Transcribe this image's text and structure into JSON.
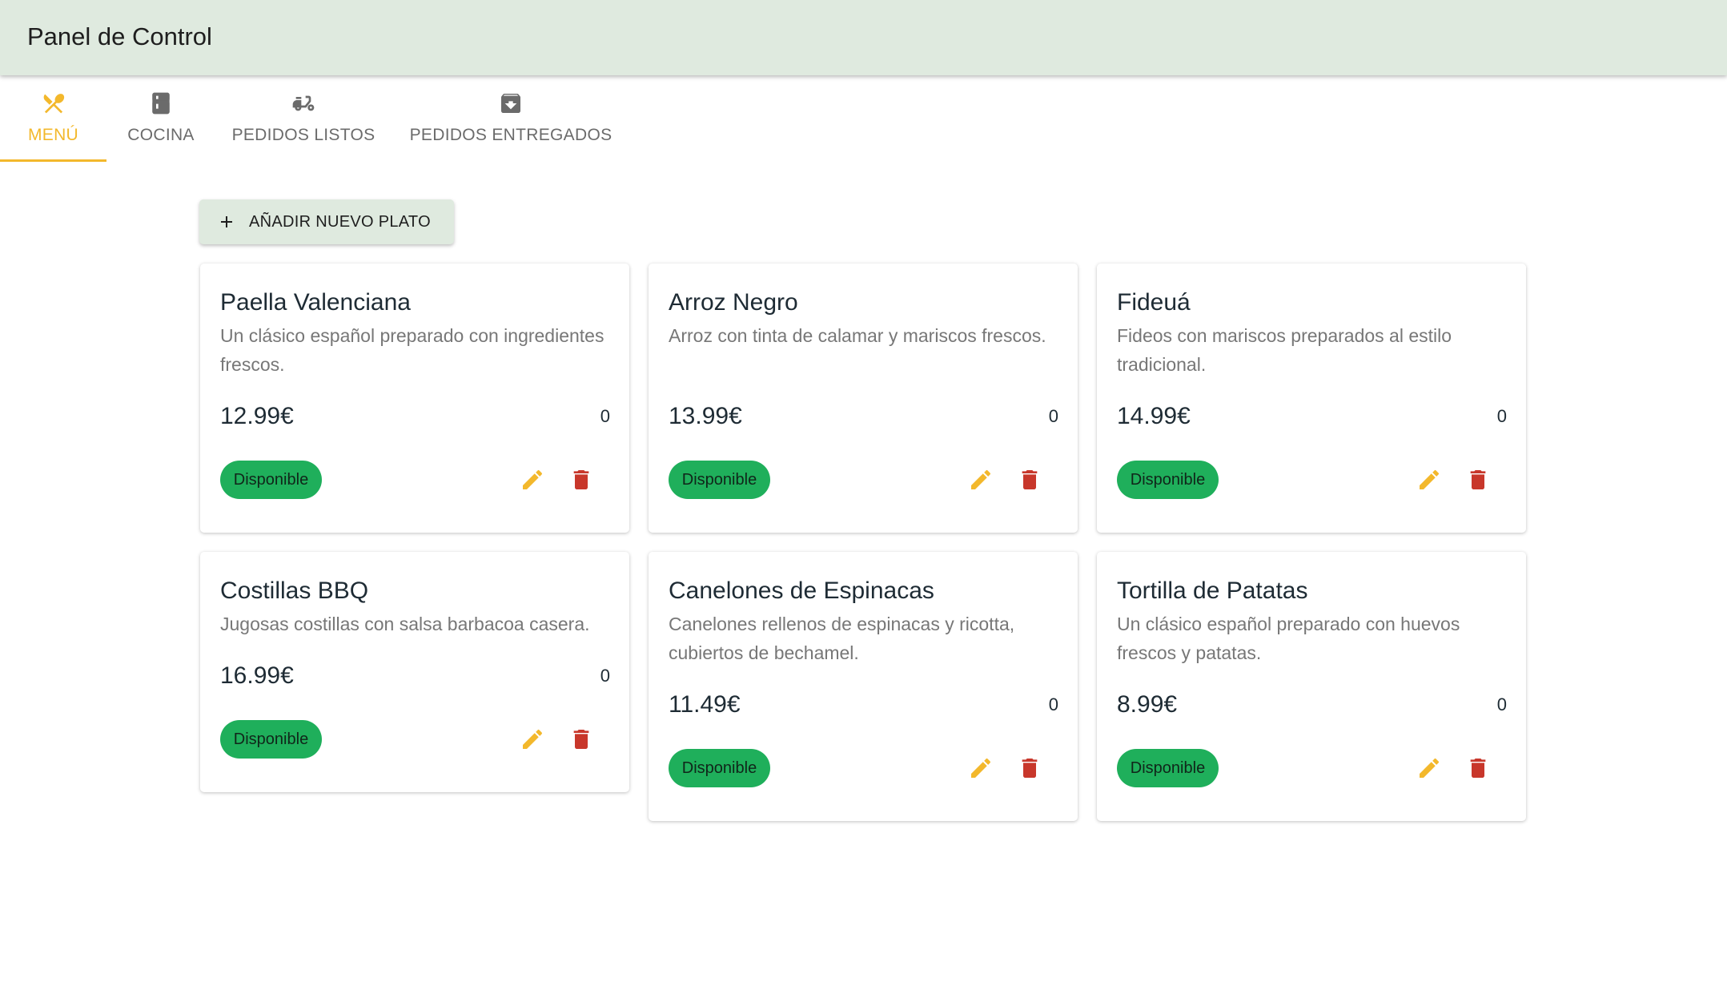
{
  "app": {
    "title": "Panel de Control"
  },
  "tabs": [
    {
      "label": "MENÚ",
      "icon": "utensils-icon",
      "active": true
    },
    {
      "label": "COCINA",
      "icon": "kitchen-icon",
      "active": false
    },
    {
      "label": "PEDIDOS LISTOS",
      "icon": "delivery-scooter-icon",
      "active": false
    },
    {
      "label": "PEDIDOS ENTREGADOS",
      "icon": "archive-box-icon",
      "active": false
    }
  ],
  "toolbar": {
    "add_label": "AÑADIR NUEVO PLATO"
  },
  "dishes": [
    {
      "name": "Paella Valenciana",
      "description": "Un clásico español preparado con ingredientes frescos.",
      "price": "12.99€",
      "count": "0",
      "status": "Disponible"
    },
    {
      "name": "Arroz Negro",
      "description": "Arroz con tinta de calamar y mariscos frescos.",
      "price": "13.99€",
      "count": "0",
      "status": "Disponible"
    },
    {
      "name": "Fideuá",
      "description": "Fideos con mariscos preparados al estilo tradicional.",
      "price": "14.99€",
      "count": "0",
      "status": "Disponible"
    },
    {
      "name": "Costillas BBQ",
      "description": "Jugosas costillas con salsa barbacoa casera.",
      "price": "16.99€",
      "count": "0",
      "status": "Disponible"
    },
    {
      "name": "Canelones de Espinacas",
      "description": "Canelones rellenos de espinacas y ricotta, cubiertos de bechamel.",
      "price": "11.49€",
      "count": "0",
      "status": "Disponible"
    },
    {
      "name": "Tortilla de Patatas",
      "description": "Un clásico español preparado con huevos frescos y patatas.",
      "price": "8.99€",
      "count": "0",
      "status": "Disponible"
    }
  ],
  "colors": {
    "accent": "#f3b82c",
    "appbar": "#dfeadf",
    "available": "#1faf5b",
    "delete": "#c8372b",
    "tab_inactive": "#6b6b6b"
  }
}
